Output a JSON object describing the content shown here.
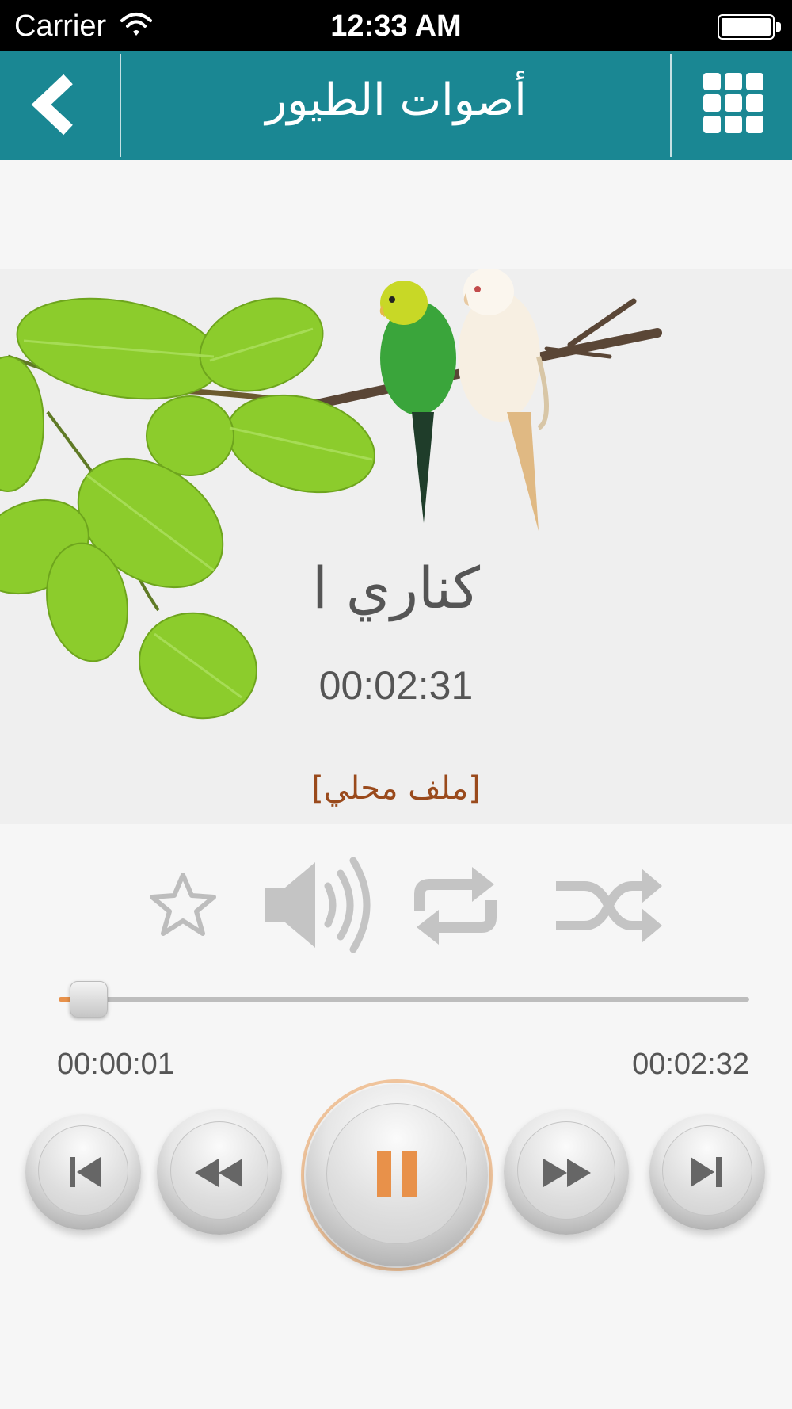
{
  "status_bar": {
    "carrier": "Carrier",
    "time": "12:33 AM"
  },
  "nav": {
    "title": "أصوات الطيور",
    "back_icon": "chevron-left-icon",
    "menu_icon": "grid-icon"
  },
  "track": {
    "title": "كناري ا",
    "duration": "00:02:31",
    "source": "[ملف محلي]"
  },
  "actions": {
    "favorite_icon": "star-icon",
    "volume_icon": "volume-icon",
    "repeat_icon": "repeat-icon",
    "shuffle_icon": "shuffle-icon"
  },
  "progress": {
    "current": "00:00:01",
    "total": "00:02:32",
    "fraction": 0.005
  },
  "controls": {
    "previous_icon": "skip-previous-icon",
    "rewind_icon": "rewind-icon",
    "pause_icon": "pause-icon",
    "forward_icon": "fast-forward-icon",
    "next_icon": "skip-next-icon"
  },
  "colors": {
    "nav_background": "#1a8793",
    "accent": "#e8914a",
    "source_text": "#9a4a1c"
  }
}
